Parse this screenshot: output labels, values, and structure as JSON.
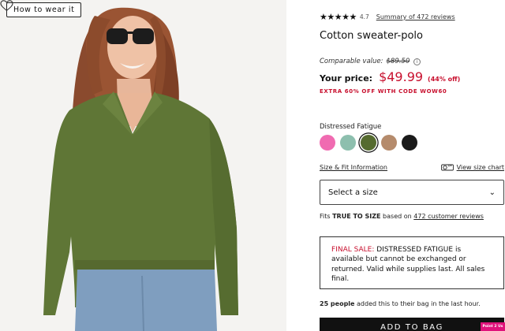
{
  "photo": {
    "how_to_wear_label": "How to wear it",
    "heart_icon": "heart-outline-icon"
  },
  "product": {
    "rating_stars": "★★★★★",
    "rating_value": "4.7",
    "reviews_link": "Summary of 472 reviews",
    "title": "Cotton sweater-polo",
    "comparable_label": "Comparable value:",
    "comparable_price": "$89.50",
    "info_icon": "i",
    "your_price_label": "Your price:",
    "your_price": "$49.99",
    "discount": "(44% off)",
    "promo": "EXTRA 60% OFF WITH CODE WOW60"
  },
  "color": {
    "selected_name": "Distressed Fatigue",
    "swatches": [
      {
        "name": "pink",
        "hex": "#f06bb1"
      },
      {
        "name": "sage",
        "hex": "#8dbfae"
      },
      {
        "name": "distressed-fatigue",
        "hex": "#556b2f",
        "selected": true
      },
      {
        "name": "camel",
        "hex": "#b58b6c"
      },
      {
        "name": "black",
        "hex": "#1a1a1a"
      }
    ]
  },
  "size": {
    "fit_info_link": "Size & Fit Information",
    "size_chart_link": "View size chart",
    "select_placeholder": "Select a size",
    "fits_prefix": "Fits ",
    "fits_bold": "TRUE TO SIZE",
    "fits_middle": " based on ",
    "fits_link": "472 customer reviews"
  },
  "final_sale": {
    "label": "FINAL SALE:",
    "text": " DISTRESSED FATIGUE is available but cannot be exchanged or returned. Valid while supplies last. All sales final."
  },
  "bag_note": {
    "count": "25 people",
    "text": " added this to their bag in the last hour."
  },
  "add_to_bag": "ADD TO BAG",
  "badge_text": "Point 2 Us",
  "colors": {
    "accent_red": "#c8102e",
    "sweater_green": "#5f7636",
    "badge_pink": "#e0127b"
  }
}
